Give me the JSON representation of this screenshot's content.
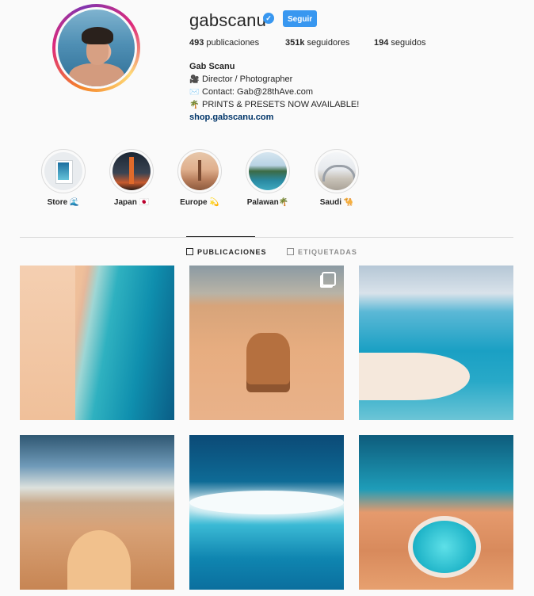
{
  "profile": {
    "username": "gabscanu",
    "follow_label": "Seguir",
    "stats": {
      "posts_count": "493",
      "posts_label": "publicaciones",
      "followers_count": "351k",
      "followers_label": "seguidores",
      "following_count": "194",
      "following_label": "seguidos"
    },
    "bio": {
      "name": "Gab Scanu",
      "lines": [
        {
          "emoji": "🎥",
          "text": "Director / Photographer"
        },
        {
          "emoji": "✉️",
          "text": "Contact: Gab@28thAve.com"
        },
        {
          "emoji": "🌴",
          "text": "PRINTS & PRESETS NOW AVAILABLE!"
        }
      ],
      "link": "shop.gabscanu.com"
    }
  },
  "highlights": [
    {
      "label": "Store 🌊",
      "thumb": "store-thumb"
    },
    {
      "label": "Japan 🇯🇵",
      "thumb": "japan-thumb"
    },
    {
      "label": "Europe 💫",
      "thumb": "europe-thumb"
    },
    {
      "label": "Palawan🌴",
      "thumb": "palawan-thumb"
    },
    {
      "label": "Saudi 🐪",
      "thumb": "saudi-thumb"
    }
  ],
  "tabs": [
    {
      "label": "PUBLICACIONES",
      "active": true
    },
    {
      "label": "ETIQUETADAS",
      "active": false
    }
  ],
  "colors": {
    "accent": "#3897f0",
    "link": "#003569",
    "text": "#262626",
    "muted": "#8e8e8e"
  }
}
